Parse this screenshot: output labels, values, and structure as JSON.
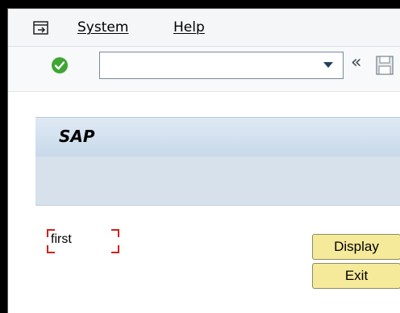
{
  "menubar": {
    "icon": "menu-enter-icon",
    "items": [
      {
        "label": "System"
      },
      {
        "label": "Help"
      }
    ]
  },
  "toolbar": {
    "command_field_value": "",
    "enter_icon": "green-checkmark-icon",
    "collapse_glyph": "«",
    "save_icon": "save-icon"
  },
  "title": {
    "text": "SAP"
  },
  "workarea": {
    "field_label": "first",
    "buttons": {
      "display": "Display",
      "exit": "Exit"
    }
  },
  "colors": {
    "enter_green": "#3fa533",
    "button_yellow": "#f5e99a",
    "focus_red": "#d0211b",
    "title_blue": "#c8d9ea"
  }
}
